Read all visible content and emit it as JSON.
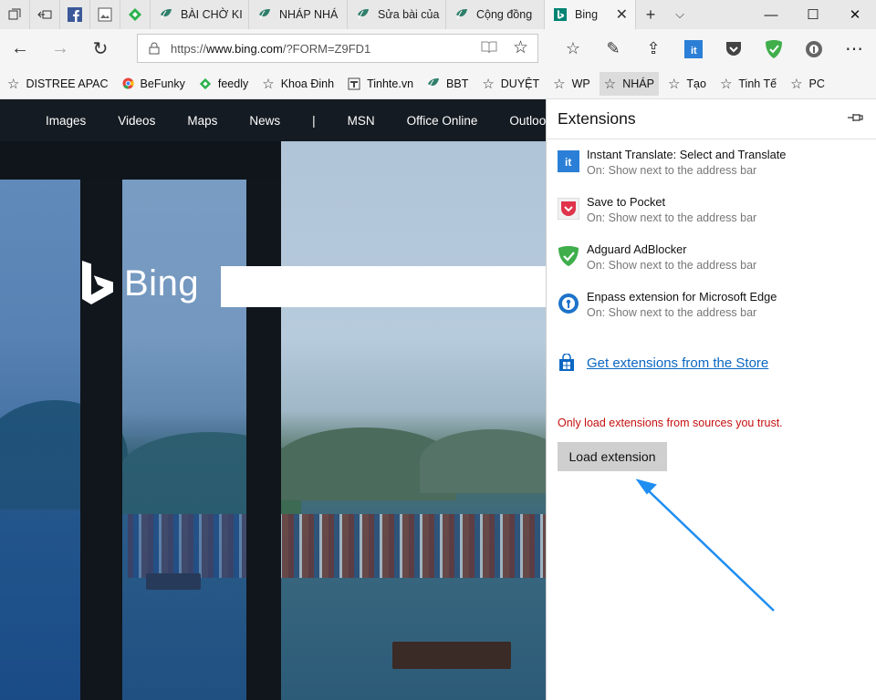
{
  "tabs": [
    {
      "label": "BÀI CHỜ KI"
    },
    {
      "label": "NHÁP NHÁ"
    },
    {
      "label": "Sửa bài của"
    },
    {
      "label": "Cộng đồng"
    },
    {
      "label": "Bing",
      "active": true
    }
  ],
  "address": {
    "url_prefix": "https://",
    "url_host": "www.bing.com",
    "url_rest": "/?FORM=Z9FD1"
  },
  "favorites": [
    {
      "label": "DISTREE APAC",
      "icon": "star-icon"
    },
    {
      "label": "BeFunky",
      "icon": "chrome-icon"
    },
    {
      "label": "feedly",
      "icon": "feedly-icon"
    },
    {
      "label": "Khoa Đinh",
      "icon": "star-icon"
    },
    {
      "label": "Tinhte.vn",
      "icon": "tinhte-icon"
    },
    {
      "label": "BBT",
      "icon": "leaf-icon"
    },
    {
      "label": "DUYỆT",
      "icon": "star-icon"
    },
    {
      "label": "WP",
      "icon": "star-icon"
    },
    {
      "label": "NHÁP",
      "icon": "star-icon"
    },
    {
      "label": "Tạo",
      "icon": "star-icon"
    },
    {
      "label": "Tinh Tế",
      "icon": "star-icon"
    },
    {
      "label": "PC",
      "icon": "star-icon"
    }
  ],
  "bing": {
    "nav": [
      "Images",
      "Videos",
      "Maps",
      "News",
      "|",
      "MSN",
      "Office Online",
      "Outlook"
    ],
    "logo_text": "Bing"
  },
  "extensions_panel": {
    "title": "Extensions",
    "items": [
      {
        "name": "Instant Translate: Select and Translate",
        "status": "On: Show next to the address bar",
        "icon": "translate-icon",
        "color": "#2b7fd6"
      },
      {
        "name": "Save to Pocket",
        "status": "On: Show next to the address bar",
        "icon": "pocket-icon",
        "color": "#e0344b"
      },
      {
        "name": "Adguard AdBlocker",
        "status": "On: Show next to the address bar",
        "icon": "adguard-icon",
        "color": "#3fae4b"
      },
      {
        "name": "Enpass extension for Microsoft Edge",
        "status": "On: Show next to the address bar",
        "icon": "enpass-icon",
        "color": "#1d73c9"
      }
    ],
    "store_link": "Get extensions from the Store",
    "warning": "Only load extensions from sources you trust.",
    "load_button": "Load extension"
  },
  "colors": {
    "accent": "#0a66c2",
    "warning": "#c50f0f",
    "annotation_arrow": "#1f8ef1"
  }
}
